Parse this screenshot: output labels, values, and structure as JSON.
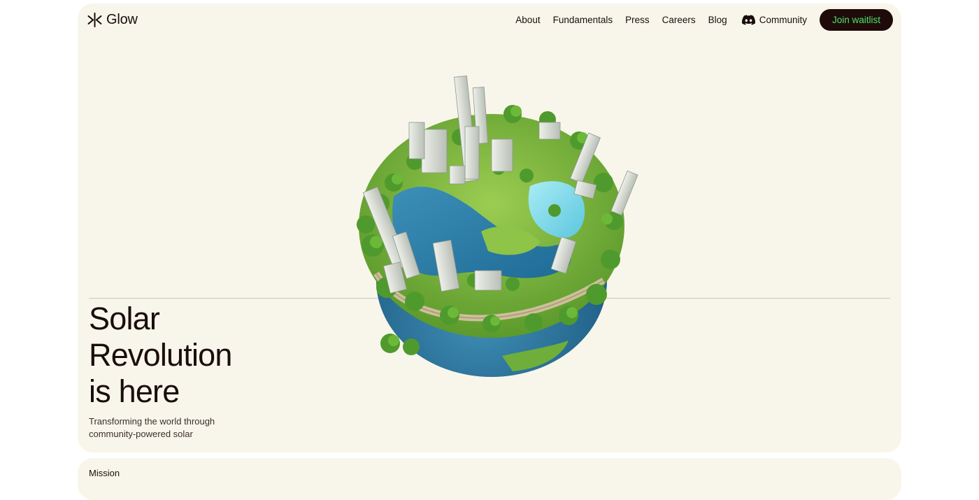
{
  "brand": {
    "name": "Glow",
    "icon": "glow-logo-icon"
  },
  "nav": {
    "links": [
      "About",
      "Fundamentals",
      "Press",
      "Careers",
      "Blog"
    ],
    "community": {
      "label": "Community",
      "icon": "discord-icon"
    },
    "cta_label": "Join waitlist"
  },
  "hero": {
    "headline": [
      "Solar",
      "Revolution",
      "is here"
    ],
    "subtitle": [
      "Transforming the world through",
      "community-powered solar"
    ],
    "image": "globe-city-illustration"
  },
  "mission": {
    "label": "Mission"
  },
  "colors": {
    "background": "#f8f6ea",
    "text": "#1a0d0d",
    "cta_bg": "#1f0a0a",
    "cta_text": "#49e36b"
  }
}
